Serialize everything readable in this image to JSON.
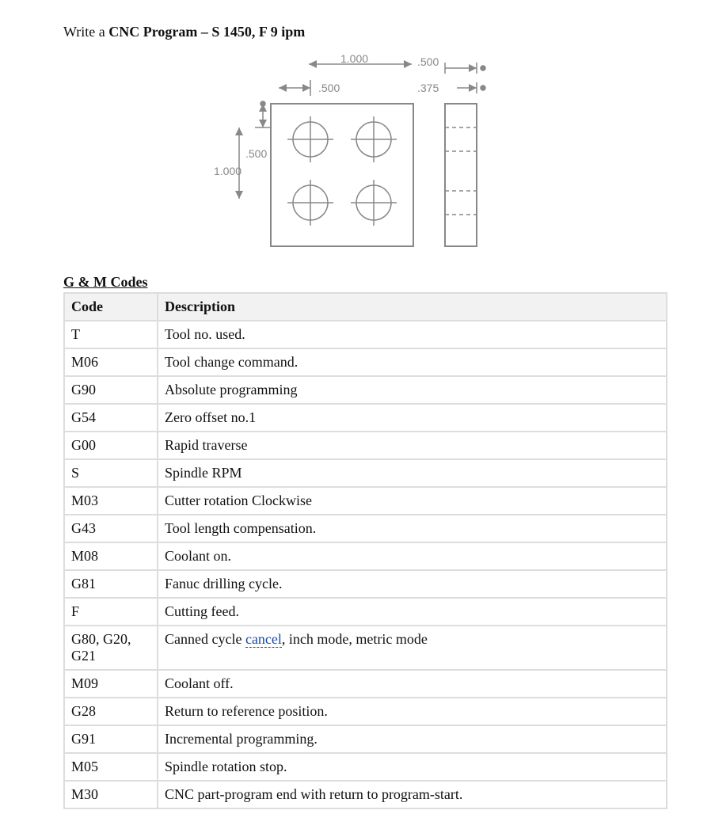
{
  "title": {
    "prefix": "Write a ",
    "bold": "CNC Program – S 1450, F 9 ipm"
  },
  "diagram": {
    "dims": {
      "top_span": "1.000",
      "top_half": ".500",
      "side_span": "1.000",
      "side_half": ".500",
      "right_width": ".500",
      "right_hole": ".375"
    }
  },
  "section_heading": "G & M Codes",
  "table": {
    "headers": [
      "Code",
      "Description"
    ],
    "rows": [
      {
        "code": "T",
        "desc_pre": "Tool no. used.",
        "link": "",
        "desc_post": ""
      },
      {
        "code": "M06",
        "desc_pre": "Tool change command.",
        "link": "",
        "desc_post": ""
      },
      {
        "code": "G90",
        "desc_pre": "Absolute programming",
        "link": "",
        "desc_post": ""
      },
      {
        "code": "G54",
        "desc_pre": "Zero offset no.1",
        "link": "",
        "desc_post": ""
      },
      {
        "code": "G00",
        "desc_pre": "Rapid traverse",
        "link": "",
        "desc_post": ""
      },
      {
        "code": "S",
        "desc_pre": "Spindle RPM",
        "link": "",
        "desc_post": ""
      },
      {
        "code": "M03",
        "desc_pre": "Cutter rotation Clockwise",
        "link": "",
        "desc_post": ""
      },
      {
        "code": "G43",
        "desc_pre": "Tool length compensation.",
        "link": "",
        "desc_post": ""
      },
      {
        "code": "M08",
        "desc_pre": "Coolant on.",
        "link": "",
        "desc_post": ""
      },
      {
        "code": "G81",
        "desc_pre": "Fanuc drilling cycle.",
        "link": "",
        "desc_post": ""
      },
      {
        "code": "F",
        "desc_pre": "Cutting feed.",
        "link": "",
        "desc_post": ""
      },
      {
        "code": "G80, G20, G21",
        "desc_pre": "Canned cycle ",
        "link": "cancel",
        "desc_post": ", inch mode, metric mode"
      },
      {
        "code": "M09",
        "desc_pre": "Coolant off.",
        "link": "",
        "desc_post": ""
      },
      {
        "code": "G28",
        "desc_pre": "Return to reference position.",
        "link": "",
        "desc_post": ""
      },
      {
        "code": "G91",
        "desc_pre": "Incremental programming.",
        "link": "",
        "desc_post": ""
      },
      {
        "code": "M05",
        "desc_pre": "Spindle rotation stop.",
        "link": "",
        "desc_post": ""
      },
      {
        "code": "M30",
        "desc_pre": "CNC part-program end with return to program-start.",
        "link": "",
        "desc_post": ""
      }
    ]
  }
}
